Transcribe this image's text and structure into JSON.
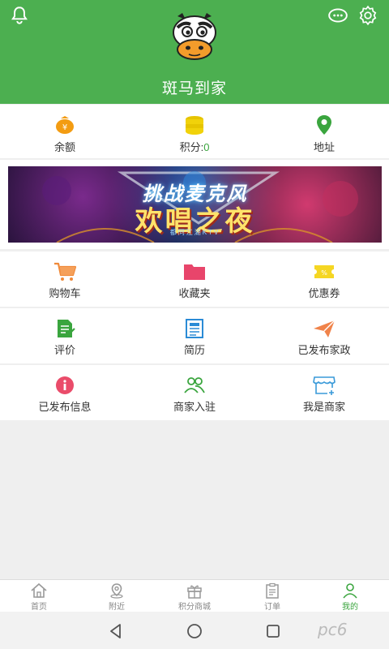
{
  "header": {
    "title": "斑马到家",
    "icons": [
      "bell-icon",
      "message-icon",
      "gear-icon"
    ],
    "color": "#4caf50"
  },
  "stats": [
    {
      "id": "balance",
      "label": "余额",
      "icon": "wallet-icon"
    },
    {
      "id": "points",
      "label": "积分:",
      "value": "0",
      "icon": "coins-icon"
    },
    {
      "id": "address",
      "label": "地址",
      "icon": "location-pin-icon"
    }
  ],
  "banner": {
    "line1": "挑战麦克风",
    "line2": "欢唱之夜",
    "line3": "都同江湖KTV"
  },
  "menu_rows": [
    [
      {
        "label": "购物车",
        "icon": "shopping-cart-icon"
      },
      {
        "label": "收藏夹",
        "icon": "folder-icon"
      },
      {
        "label": "优惠券",
        "icon": "coupon-icon"
      }
    ],
    [
      {
        "label": "评价",
        "icon": "review-icon"
      },
      {
        "label": "简历",
        "icon": "resume-icon"
      },
      {
        "label": "已发布家政",
        "icon": "paper-plane-icon"
      }
    ],
    [
      {
        "label": "已发布信息",
        "icon": "info-icon"
      },
      {
        "label": "商家入驻",
        "icon": "users-icon"
      },
      {
        "label": "我是商家",
        "icon": "shop-icon"
      }
    ]
  ],
  "bottom_nav": [
    {
      "label": "首页",
      "icon": "home-icon",
      "active": false
    },
    {
      "label": "附近",
      "icon": "map-pin-icon",
      "active": false
    },
    {
      "label": "积分商城",
      "icon": "gift-icon",
      "active": false
    },
    {
      "label": "订单",
      "icon": "clipboard-icon",
      "active": false
    },
    {
      "label": "我的",
      "icon": "user-icon",
      "active": true
    }
  ],
  "watermark": "pc6",
  "colors": {
    "accent": "#3aa53e"
  }
}
